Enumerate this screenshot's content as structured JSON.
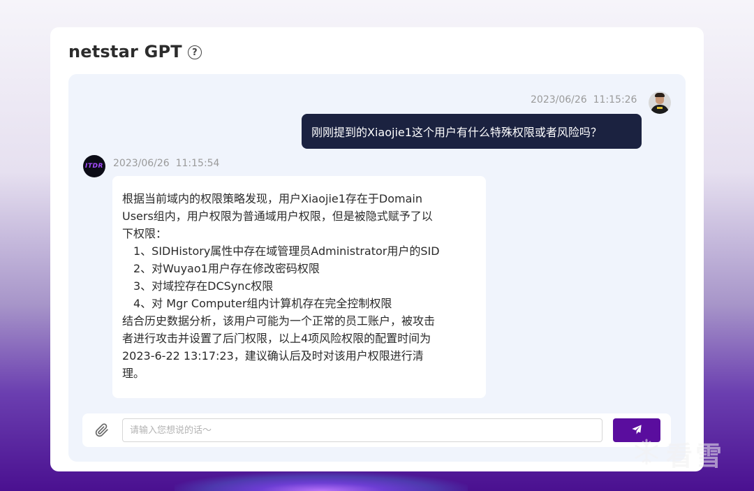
{
  "header": {
    "title": "netstar GPT",
    "help_icon": "?"
  },
  "messages": {
    "user": {
      "timestamp": "2023/06/26  11:15:26",
      "text": "刚刚提到的Xiaojie1这个用户有什么特殊权限或者风险吗？"
    },
    "bot": {
      "avatar_text": "ITDR",
      "timestamp": "2023/06/26  11:15:54",
      "lines": [
        "根据当前域内的权限策略发现，用户Xiaojie1存在于Domain",
        "Users组内，用户权限为普通域用户权限，但是被隐式赋予了以",
        "下权限：",
        "1、SIDHistory属性中存在域管理员Administrator用户的SID",
        "2、对Wuyao1用户存在修改密码权限",
        "3、对域控存在DCSync权限",
        "4、对 Mgr Computer组内计算机存在完全控制权限",
        "结合历史数据分析，该用户可能为一个正常的员工账户，被攻击",
        "者进行攻击并设置了后门权限，以上4项风险权限的配置时间为",
        "2023-6-22 13:17:23，建议确认后及时对该用户权限进行清",
        "理。"
      ]
    }
  },
  "composer": {
    "placeholder": "请输入您想说的话～",
    "value": ""
  },
  "watermark": {
    "text": "看雪"
  },
  "colors": {
    "brand": "#5a0d9e",
    "user_bubble": "#1b2240",
    "panel": "#f0f4fc"
  }
}
